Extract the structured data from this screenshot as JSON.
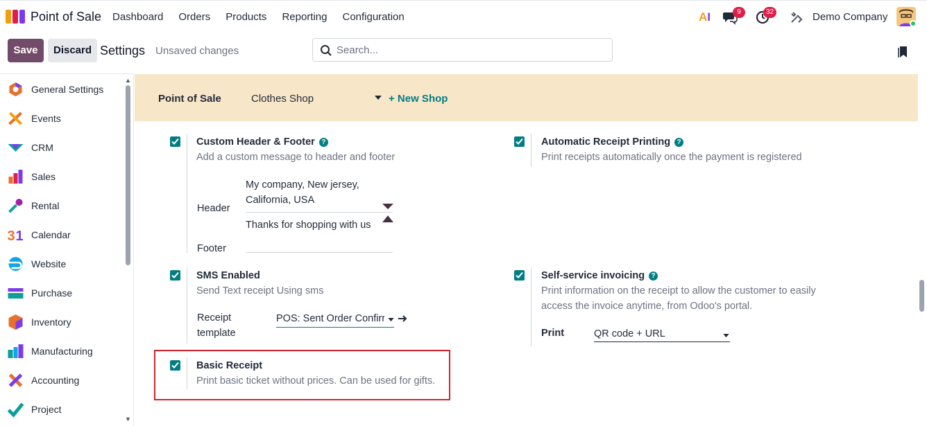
{
  "topbar": {
    "app_name": "Point of Sale",
    "menu": [
      "Dashboard",
      "Orders",
      "Products",
      "Reporting",
      "Configuration"
    ],
    "messages_count": "9",
    "activities_count": "32",
    "company": "Demo Company"
  },
  "controlbar": {
    "save_label": "Save",
    "discard_label": "Discard",
    "title": "Settings",
    "status": "Unsaved changes",
    "search_placeholder": "Search..."
  },
  "sidebar": {
    "items": [
      {
        "label": "General Settings",
        "icon": "general-settings-icon"
      },
      {
        "label": "Events",
        "icon": "events-icon"
      },
      {
        "label": "CRM",
        "icon": "crm-icon"
      },
      {
        "label": "Sales",
        "icon": "sales-icon"
      },
      {
        "label": "Rental",
        "icon": "rental-icon"
      },
      {
        "label": "Calendar",
        "icon": "calendar-icon"
      },
      {
        "label": "Website",
        "icon": "website-icon"
      },
      {
        "label": "Purchase",
        "icon": "purchase-icon"
      },
      {
        "label": "Inventory",
        "icon": "inventory-icon"
      },
      {
        "label": "Manufacturing",
        "icon": "manufacturing-icon"
      },
      {
        "label": "Accounting",
        "icon": "accounting-icon"
      },
      {
        "label": "Project",
        "icon": "project-icon"
      }
    ]
  },
  "shopbar": {
    "label": "Point of Sale",
    "selected_shop": "Clothes Shop",
    "new_shop_label": "+ New Shop"
  },
  "settings": {
    "custom_header_footer": {
      "title": "Custom Header & Footer",
      "description": "Add a custom message to header and footer",
      "checked": true,
      "header_label": "Header",
      "header_line1": "My  company, New jersey,",
      "header_line2": "California, USA",
      "header_line3": "Thanks for shopping with us",
      "footer_label": "Footer",
      "footer_value": ""
    },
    "automatic_receipt_printing": {
      "title": "Automatic Receipt Printing",
      "description": "Print receipts automatically once the payment is registered",
      "checked": true
    },
    "sms_enabled": {
      "title": "SMS Enabled",
      "description": "Send Text receipt Using sms",
      "checked": true,
      "template_label_1": "Receipt",
      "template_label_2": "template",
      "template_value": "POS: Sent Order Confirr"
    },
    "self_service_invoicing": {
      "title": "Self-service invoicing",
      "description_line1": "Print information on the receipt to allow the customer to easily",
      "description_line2": "access the invoice anytime, from Odoo's portal.",
      "checked": true,
      "print_label": "Print",
      "print_value": "QR code + URL"
    },
    "basic_receipt": {
      "title": "Basic Receipt",
      "description": "Print basic ticket without prices. Can be used for gifts.",
      "checked": true
    }
  },
  "colors": {
    "brand": "#714b67",
    "accent": "#017e84",
    "shopbar_bg": "#f8e6c8",
    "highlight": "#d3202f"
  }
}
